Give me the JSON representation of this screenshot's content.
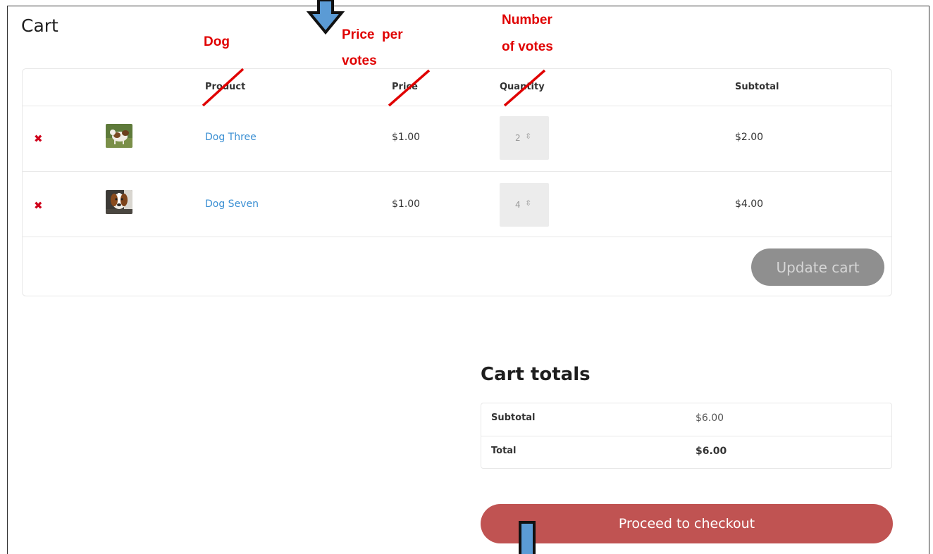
{
  "page": {
    "title": "Cart"
  },
  "table": {
    "headers": {
      "product": "Product",
      "price": "Price",
      "quantity": "Quantity",
      "subtotal": "Subtotal"
    },
    "rows": [
      {
        "name": "Dog Three",
        "price": "$1.00",
        "quantity": "2",
        "subtotal": "$2.00"
      },
      {
        "name": "Dog Seven",
        "price": "$1.00",
        "quantity": "4",
        "subtotal": "$4.00"
      }
    ],
    "update_label": "Update cart"
  },
  "totals": {
    "title": "Cart totals",
    "subtotal_label": "Subtotal",
    "subtotal_value": "$6.00",
    "total_label": "Total",
    "total_value": "$6.00"
  },
  "checkout_label": "Proceed to checkout",
  "annotations": {
    "product": "Dog",
    "price_line1": "Price  per",
    "price_line2": "votes",
    "quantity_line1": "Number",
    "quantity_line2": "of votes"
  },
  "icons": {
    "remove": "remove-x-icon",
    "spinner": "spin-arrows-icon",
    "arrow": "blue-arrow-icon"
  },
  "colors": {
    "accent_link": "#3a8fd3",
    "remove": "#d0021b",
    "checkout": "#c05352",
    "update_disabled": "#8f8f8f",
    "annotation": "#e00000",
    "arrow_fill": "#5b9bd5"
  }
}
